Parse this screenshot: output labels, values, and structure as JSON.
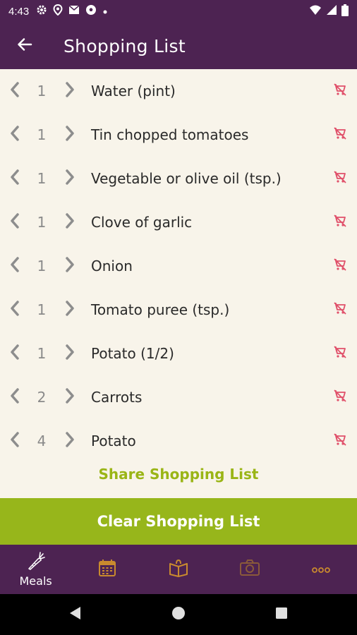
{
  "status_bar": {
    "time": "4:43",
    "left_icons": [
      "gear-icon",
      "location-icon",
      "mail-icon",
      "soccer-icon",
      "dot-icon"
    ],
    "right_icons": [
      "wifi-icon",
      "signal-icon",
      "battery-icon"
    ]
  },
  "app_bar": {
    "title": "Shopping List",
    "back_icon": "arrow-left-icon"
  },
  "items": [
    {
      "qty": "1",
      "name": "Water (pint)"
    },
    {
      "qty": "1",
      "name": "Tin chopped tomatoes"
    },
    {
      "qty": "1",
      "name": "Vegetable or olive oil (tsp.)"
    },
    {
      "qty": "1",
      "name": "Clove of garlic"
    },
    {
      "qty": "1",
      "name": "Onion"
    },
    {
      "qty": "1",
      "name": "Tomato puree (tsp.)"
    },
    {
      "qty": "1",
      "name": "Potato (1/2)"
    },
    {
      "qty": "2",
      "name": "Carrots"
    },
    {
      "qty": "4",
      "name": "Potato"
    }
  ],
  "actions": {
    "share_label": "Share Shopping List",
    "clear_label": "Clear Shopping List"
  },
  "bottom_nav": {
    "items": [
      {
        "label": "Meals",
        "icon": "carrot-icon"
      },
      {
        "label": "",
        "icon": "calendar-icon"
      },
      {
        "label": "",
        "icon": "recipe-book-icon"
      },
      {
        "label": "",
        "icon": "camera-icon"
      },
      {
        "label": "",
        "icon": "more-icon"
      }
    ]
  },
  "colors": {
    "primary": "#4d2352",
    "accent": "#97b61b",
    "background": "#f8f4ea",
    "remove": "#e0506a",
    "nav_icon": "#c98a2e"
  }
}
